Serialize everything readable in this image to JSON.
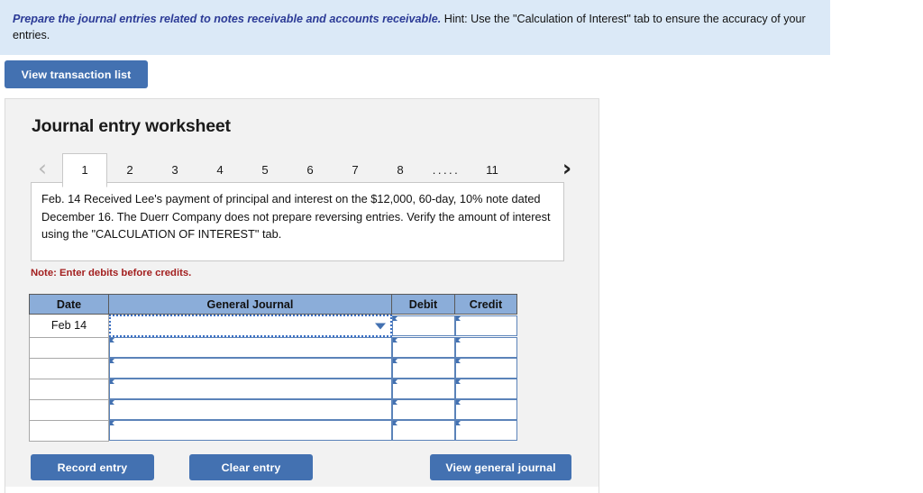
{
  "banner": {
    "lead": "Prepare the journal entries related to notes receivable and accounts receivable.",
    "rest": " Hint:  Use the \"Calculation of Interest\" tab to ensure the accuracy of your entries."
  },
  "toolbar": {
    "view_transaction_list": "View transaction list"
  },
  "panel": {
    "title": "Journal entry worksheet",
    "prev_icon": "chevron-left",
    "next_icon": "chevron-right",
    "tabs": [
      {
        "label": "1",
        "active": true
      },
      {
        "label": "2",
        "active": false
      },
      {
        "label": "3",
        "active": false
      },
      {
        "label": "4",
        "active": false
      },
      {
        "label": "5",
        "active": false
      },
      {
        "label": "6",
        "active": false
      },
      {
        "label": "7",
        "active": false
      },
      {
        "label": "8",
        "active": false
      },
      {
        "label": ".....",
        "active": false
      },
      {
        "label": "11",
        "active": false
      }
    ],
    "prompt": "Feb. 14 Received Lee's payment of principal and interest on the $12,000, 60-day, 10% note dated December 16. The Duerr Company does not prepare reversing entries. Verify the amount of interest using the \"CALCULATION OF INTEREST\" tab.",
    "note": "Note: Enter debits before credits."
  },
  "table": {
    "headers": [
      "Date",
      "General Journal",
      "Debit",
      "Credit"
    ],
    "rows": [
      {
        "date": "Feb 14",
        "general_journal": "",
        "debit": "",
        "credit": "",
        "focused": true
      },
      {
        "date": "",
        "general_journal": "",
        "debit": "",
        "credit": "",
        "focused": false
      },
      {
        "date": "",
        "general_journal": "",
        "debit": "",
        "credit": "",
        "focused": false
      },
      {
        "date": "",
        "general_journal": "",
        "debit": "",
        "credit": "",
        "focused": false
      },
      {
        "date": "",
        "general_journal": "",
        "debit": "",
        "credit": "",
        "focused": false
      },
      {
        "date": "",
        "general_journal": "",
        "debit": "",
        "credit": "",
        "focused": false
      }
    ]
  },
  "actions": {
    "record_entry": "Record entry",
    "clear_entry": "Clear entry",
    "view_general_journal": "View general journal"
  },
  "colors": {
    "banner_bg": "#dbe9f7",
    "lead_text": "#2b3a96",
    "button_blue": "#4371b1",
    "table_header_blue": "#8badd9",
    "note_red": "#a32020",
    "panel_bg": "#f2f2f2"
  }
}
